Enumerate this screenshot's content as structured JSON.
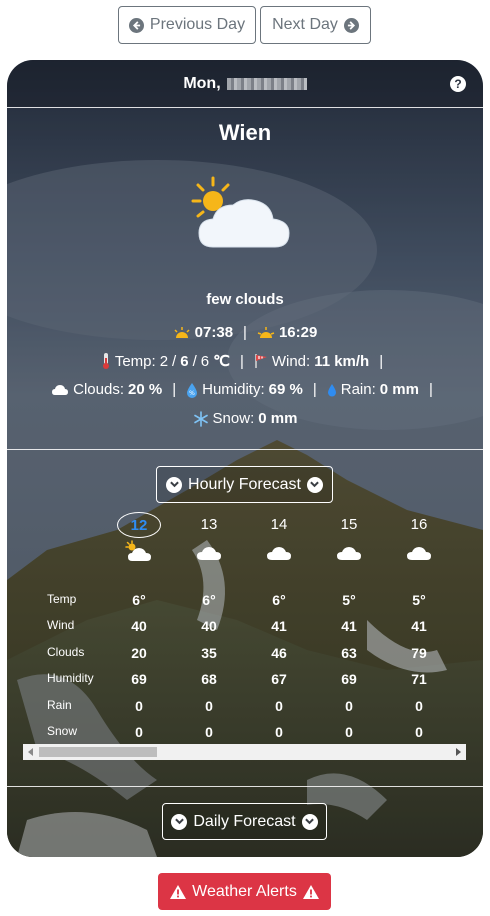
{
  "nav": {
    "prev_label": "Previous Day",
    "next_label": "Next Day"
  },
  "header": {
    "date_prefix": "Mon,"
  },
  "location": {
    "city": "Wien"
  },
  "current": {
    "description": "few clouds",
    "sunrise": "07:38",
    "sunset": "16:29",
    "temp_label": "Temp:",
    "temp_min": "2",
    "temp_current": "6",
    "temp_max": "6",
    "temp_unit": "℃",
    "wind_label": "Wind:",
    "wind_value": "11 km/h",
    "clouds_label": "Clouds:",
    "clouds_value": "20 %",
    "humidity_label": "Humidity:",
    "humidity_value": "69 %",
    "rain_label": "Rain:",
    "rain_value": "0 mm",
    "snow_label": "Snow:",
    "snow_value": "0 mm",
    "separator": "|",
    "slash": "/"
  },
  "hourly": {
    "toggle_label": "Hourly Forecast",
    "row_labels": [
      "Temp",
      "Wind",
      "Clouds",
      "Humidity",
      "Rain",
      "Snow"
    ],
    "hours": [
      {
        "hour": "12",
        "temp": "6°",
        "wind": "40",
        "clouds": "20",
        "humidity": "69",
        "rain": "0",
        "snow": "0"
      },
      {
        "hour": "13",
        "temp": "6°",
        "wind": "40",
        "clouds": "35",
        "humidity": "68",
        "rain": "0",
        "snow": "0"
      },
      {
        "hour": "14",
        "temp": "6°",
        "wind": "41",
        "clouds": "46",
        "humidity": "67",
        "rain": "0",
        "snow": "0"
      },
      {
        "hour": "15",
        "temp": "5°",
        "wind": "41",
        "clouds": "63",
        "humidity": "69",
        "rain": "0",
        "snow": "0"
      },
      {
        "hour": "16",
        "temp": "5°",
        "wind": "41",
        "clouds": "79",
        "humidity": "71",
        "rain": "0",
        "snow": "0"
      }
    ]
  },
  "daily": {
    "toggle_label": "Daily Forecast"
  },
  "alerts": {
    "label": "Weather Alerts"
  },
  "colors": {
    "accent_blue": "#2f8cf0",
    "alert_red": "#dc3545",
    "sun_yellow": "#f6b619"
  },
  "icons": [
    "arrow-left-circle-icon",
    "arrow-right-circle-icon",
    "help-icon",
    "few-clouds-icon",
    "sunrise-icon",
    "sunset-icon",
    "thermometer-icon",
    "wind-flag-icon",
    "cloud-icon",
    "humidity-icon",
    "rain-drop-icon",
    "snowflake-icon",
    "chevron-down-icon",
    "warning-icon"
  ]
}
